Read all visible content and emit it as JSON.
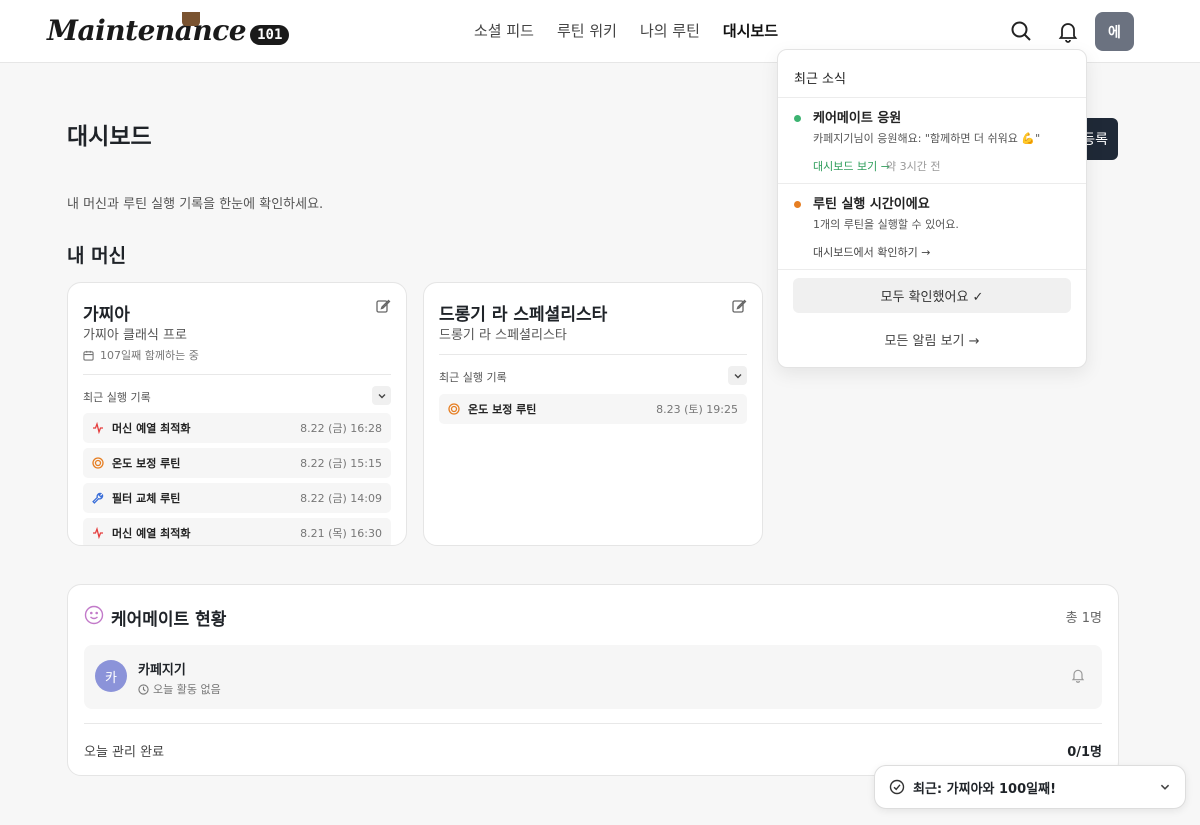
{
  "header": {
    "logo_text": "Maintenance",
    "logo_badge": "101",
    "nav": [
      {
        "label": "소셜 피드"
      },
      {
        "label": "루틴 위키"
      },
      {
        "label": "나의 루틴"
      },
      {
        "label": "대시보드"
      }
    ],
    "active_nav": "대시보드",
    "avatar_initial": "에"
  },
  "page": {
    "title": "대시보드",
    "subtitle": "내 머신과 루틴 실행 기록을 한눈에 확인하세요.",
    "add_button_label": "등록",
    "section_title": "내 머신"
  },
  "machines": [
    {
      "name": "가찌아",
      "model": "가찌아 클래식 프로",
      "days": "107일째 함께하는 중",
      "log_title": "최근 실행 기록",
      "logs": [
        {
          "icon": "activity-icon",
          "name": "머신 예열 최적화",
          "time": "8.22 (금) 16:28"
        },
        {
          "icon": "target-icon",
          "name": "온도 보정 루틴",
          "time": "8.22 (금) 15:15"
        },
        {
          "icon": "wrench-icon",
          "name": "필터 교체 루틴",
          "time": "8.22 (금) 14:09"
        },
        {
          "icon": "activity-icon",
          "name": "머신 예열 최적화",
          "time": "8.21 (목) 16:30"
        }
      ]
    },
    {
      "name": "드롱기 라 스페셜리스타",
      "model": "드롱기 라 스페셜리스타",
      "log_title": "최근 실행 기록",
      "logs": [
        {
          "icon": "target-icon",
          "name": "온도 보정 루틴",
          "time": "8.23 (토) 19:25"
        }
      ]
    }
  ],
  "caremate": {
    "title": "케어메이트 현황",
    "count": "총 1명",
    "members": [
      {
        "initial": "카",
        "name": "카페지기",
        "status": "오늘 활동 없음"
      }
    ],
    "done_label": "오늘 관리 완료",
    "done_value": "0/1명"
  },
  "notifications": {
    "title": "최근 소식",
    "items": [
      {
        "dot_color": "#3cb371",
        "title": "케어메이트 응원",
        "body": "카페지기님이 응원해요: \"함께하면 더 쉬워요 💪\"",
        "link": "대시보드 보기 →",
        "link_color": "#2e9d5a",
        "time": "약 3시간 전"
      },
      {
        "dot_color": "#e67e22",
        "title": "루틴 실행 시간이에요",
        "body": "1개의 루틴을 실행할 수 있어요.",
        "link": "대시보드에서 확인하기 →",
        "link_color": "#444444"
      }
    ],
    "ack_label": "모두 확인했어요 ✓",
    "all_label": "모든 알림 보기 →"
  },
  "toast": {
    "text": "최근: 가찌아와 100일째!"
  }
}
